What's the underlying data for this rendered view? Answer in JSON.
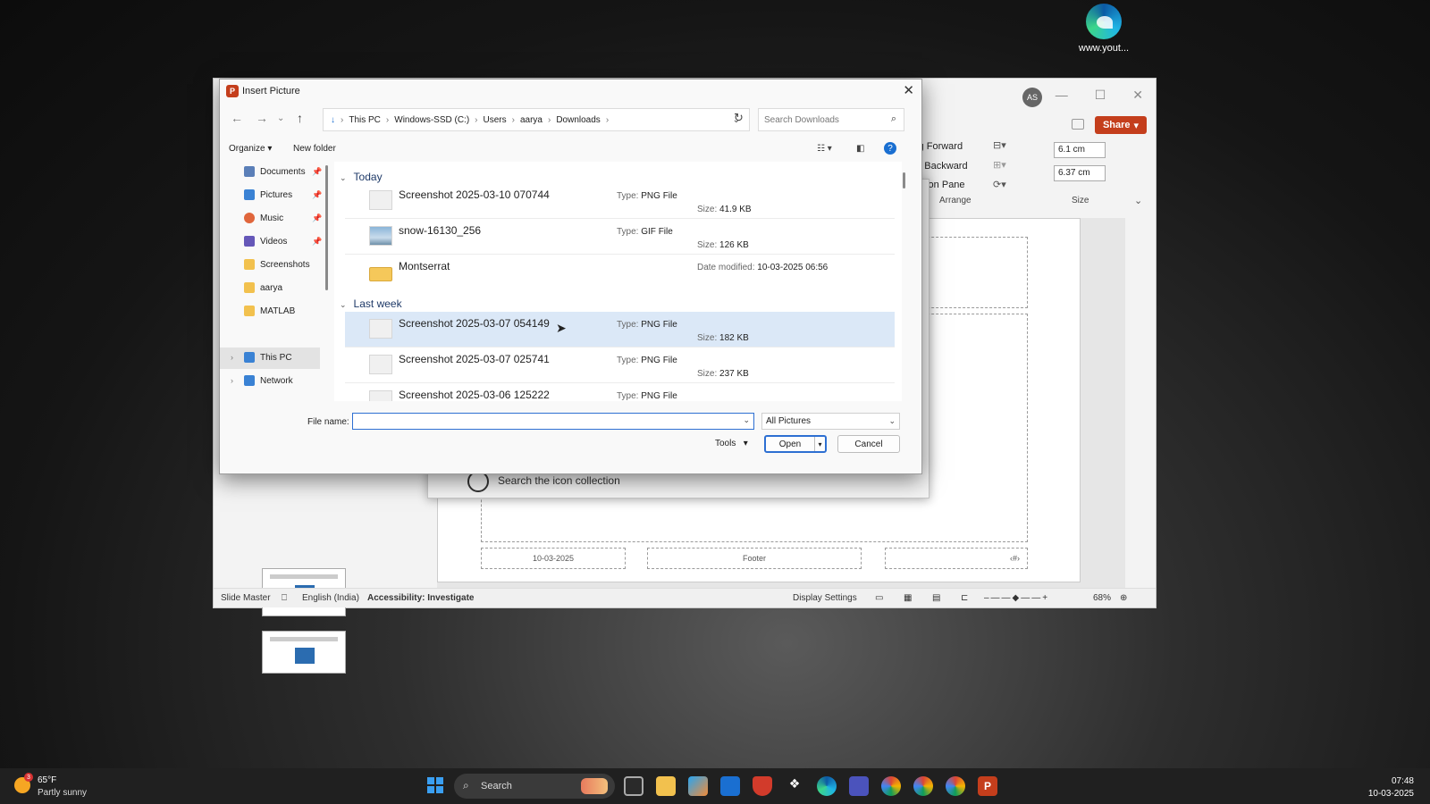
{
  "desktop": {
    "shortcut_label": "www.yout..."
  },
  "powerpoint": {
    "avatar": "AS",
    "share_label": "Share",
    "ribbon": {
      "bring_forward": "ing Forward",
      "send_backward": "nd Backward",
      "selection_pane": "lection Pane",
      "arrange_label": "Arrange",
      "size_label": "Size",
      "height_value": "6.1 cm",
      "width_value": "6.37 cm"
    },
    "slide": {
      "date": "10-03-2025",
      "footer": "Footer",
      "page_number": "‹#›"
    },
    "icon_popup": {
      "search_text": "Search the icon collection"
    },
    "statusbar": {
      "view": "Slide Master",
      "language": "English (India)",
      "accessibility": "Accessibility: Investigate",
      "display_settings": "Display Settings",
      "zoom": "68%"
    }
  },
  "dialog": {
    "title": "Insert Picture",
    "breadcrumb": [
      "This PC",
      "Windows-SSD (C:)",
      "Users",
      "aarya",
      "Downloads"
    ],
    "search_placeholder": "Search Downloads",
    "organize_label": "Organize",
    "new_folder_label": "New folder",
    "nav_pane": [
      {
        "label": "Documents",
        "pinned": true,
        "color": "#5b7fb8"
      },
      {
        "label": "Pictures",
        "pinned": true,
        "color": "#3a82d4"
      },
      {
        "label": "Music",
        "pinned": true,
        "color": "#e0663c"
      },
      {
        "label": "Videos",
        "pinned": true,
        "color": "#6557b8"
      },
      {
        "label": "Screenshots",
        "pinned": false,
        "color": "#f2c14e"
      },
      {
        "label": "aarya",
        "pinned": false,
        "color": "#f2c14e"
      },
      {
        "label": "MATLAB",
        "pinned": false,
        "color": "#f2c14e"
      }
    ],
    "nav_tree": [
      {
        "label": "This PC",
        "selected": true,
        "color": "#3a82d4"
      },
      {
        "label": "Network",
        "selected": false,
        "color": "#3a82d4"
      }
    ],
    "groups": {
      "today": "Today",
      "last_week": "Last week"
    },
    "files_today": [
      {
        "name": "Screenshot 2025-03-10 070744",
        "type_label": "Type:",
        "type": "PNG File",
        "size_label": "Size:",
        "size": "41.9 KB",
        "kind": "png"
      },
      {
        "name": "snow-16130_256",
        "type_label": "Type:",
        "type": "GIF File",
        "size_label": "Size:",
        "size": "126 KB",
        "kind": "gif"
      },
      {
        "name": "Montserrat",
        "date_label": "Date modified:",
        "date": "10-03-2025 06:56",
        "kind": "folder"
      }
    ],
    "files_last_week": [
      {
        "name": "Screenshot 2025-03-07 054149",
        "type_label": "Type:",
        "type": "PNG File",
        "size_label": "Size:",
        "size": "182 KB",
        "selected": true
      },
      {
        "name": "Screenshot 2025-03-07 025741",
        "type_label": "Type:",
        "type": "PNG File",
        "size_label": "Size:",
        "size": "237 KB"
      },
      {
        "name": "Screenshot 2025-03-06 125222",
        "type_label": "Type:",
        "type": "PNG File"
      }
    ],
    "file_name_label": "File name:",
    "file_name_value": "",
    "file_type_value": "All Pictures",
    "tools_label": "Tools",
    "open_label": "Open",
    "cancel_label": "Cancel"
  },
  "taskbar": {
    "weather_temp": "65°F",
    "weather_cond": "Partly sunny",
    "weather_badge": "3",
    "search_label": "Search",
    "time": "07:48",
    "date": "10-03-2025"
  }
}
